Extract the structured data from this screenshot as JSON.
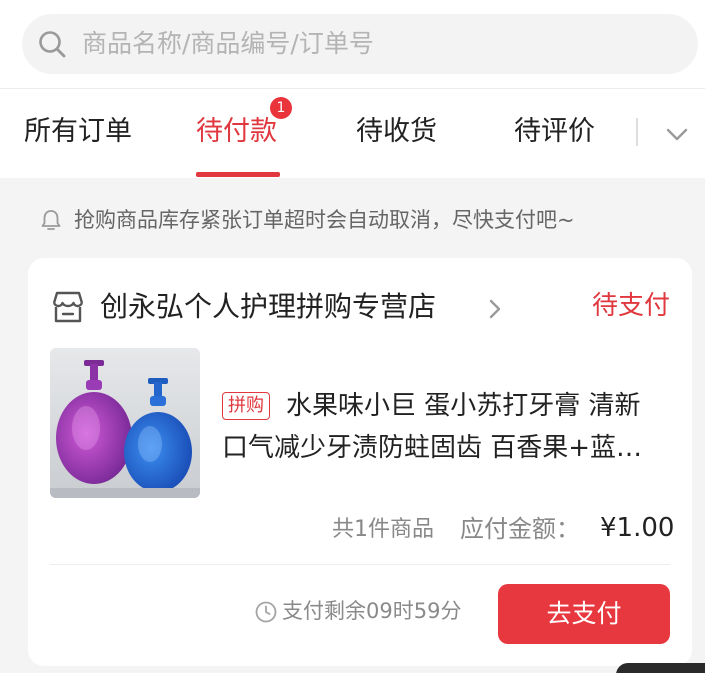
{
  "search": {
    "placeholder": "商品名称/商品编号/订单号"
  },
  "tabs": [
    {
      "label": "所有订单",
      "active": false
    },
    {
      "label": "待付款",
      "active": true,
      "badge": "1"
    },
    {
      "label": "待收货",
      "active": false
    },
    {
      "label": "待评价",
      "active": false
    }
  ],
  "notice": {
    "text": "抢购商品库存紧张订单超时会自动取消，尽快支付吧~"
  },
  "order": {
    "store_name": "创永弘个人护理拼购专营店",
    "status": "待支付",
    "product": {
      "tag": "拼购",
      "title_line1": "水果味小巨 蛋小苏打牙膏 清新",
      "title_line2": "口气减少牙渍防蛀固齿 百香果+蓝…"
    },
    "summary": {
      "count_text": "共1件商品",
      "amount_label": "应付金额：",
      "amount": "¥1.00"
    },
    "countdown_text": "支付剩余09时59分",
    "pay_button_label": "去支付"
  },
  "colors": {
    "accent": "#e0383e",
    "page_bg": "#f4f4f4",
    "card_bg": "#ffffff"
  },
  "icons": [
    "search-icon",
    "chevron-down-icon",
    "bell-icon",
    "store-icon",
    "chevron-right-icon",
    "clock-icon"
  ]
}
